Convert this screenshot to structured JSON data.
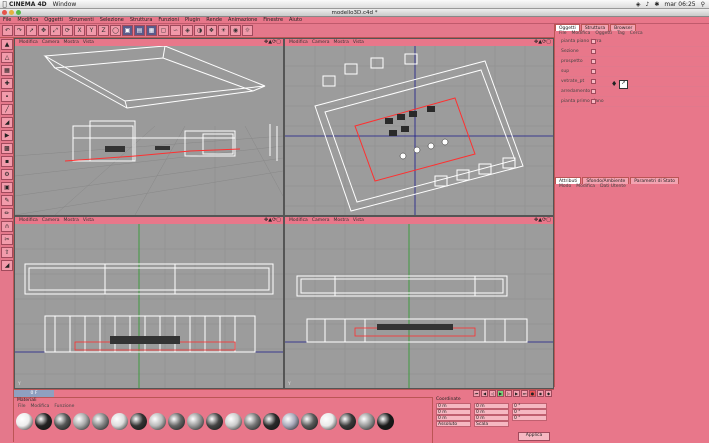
{
  "macbar": {
    "app_name": "CINEMA 4D",
    "menu": [
      "Window"
    ],
    "clock": "mar 06:25"
  },
  "window": {
    "title": "modello3D.c4d *"
  },
  "app_menu": [
    "File",
    "Modifica",
    "Oggetti",
    "Strumenti",
    "Selezione",
    "Struttura",
    "Funzioni",
    "Plugin",
    "Rende",
    "Animazione",
    "Finestre",
    "Aiuto"
  ],
  "viewports": [
    {
      "menu": [
        "Modifica",
        "Camera",
        "Mostra",
        "Vista"
      ],
      "label": ""
    },
    {
      "menu": [
        "Modifica",
        "Camera",
        "Mostra",
        "Vista"
      ],
      "label": "Y"
    },
    {
      "menu": [
        "Modifica",
        "Camera",
        "Mostra",
        "Vista"
      ],
      "label": "Y"
    },
    {
      "menu": [
        "Modifica",
        "Camera",
        "Mostra",
        "Vista"
      ],
      "label": "Y"
    }
  ],
  "object_manager": {
    "tabs": [
      "Oggetti",
      "Struttura",
      "Browser"
    ],
    "menu": [
      "File",
      "Modifica",
      "Oggetti",
      "Tag",
      "Cerca"
    ],
    "rows": [
      "pianta piano terra",
      "Sezione",
      "prospetto",
      "sup",
      "vetrate_pt",
      "arredamento",
      "pianta primo piano"
    ]
  },
  "attributes_manager": {
    "tabs": [
      "Attributi",
      "Sfondo/Ambiente",
      "Parametri di Stato"
    ],
    "menu": [
      "Modo",
      "Modifica",
      "Dati Utente"
    ]
  },
  "timeline": {
    "frame": "0 F"
  },
  "materials": {
    "title": "Materiali",
    "menu": [
      "File",
      "Modifica",
      "Funzione"
    ],
    "count": 20
  },
  "coordinates": {
    "title": "Coordinate",
    "rows": [
      [
        "0 m",
        "0 m",
        "0 °"
      ],
      [
        "0 m",
        "0 m",
        "0 °"
      ],
      [
        "0 m",
        "0 m",
        "0 °"
      ]
    ],
    "mode": "Assoluto",
    "size_mode": "Scala",
    "apply": "Applica"
  }
}
